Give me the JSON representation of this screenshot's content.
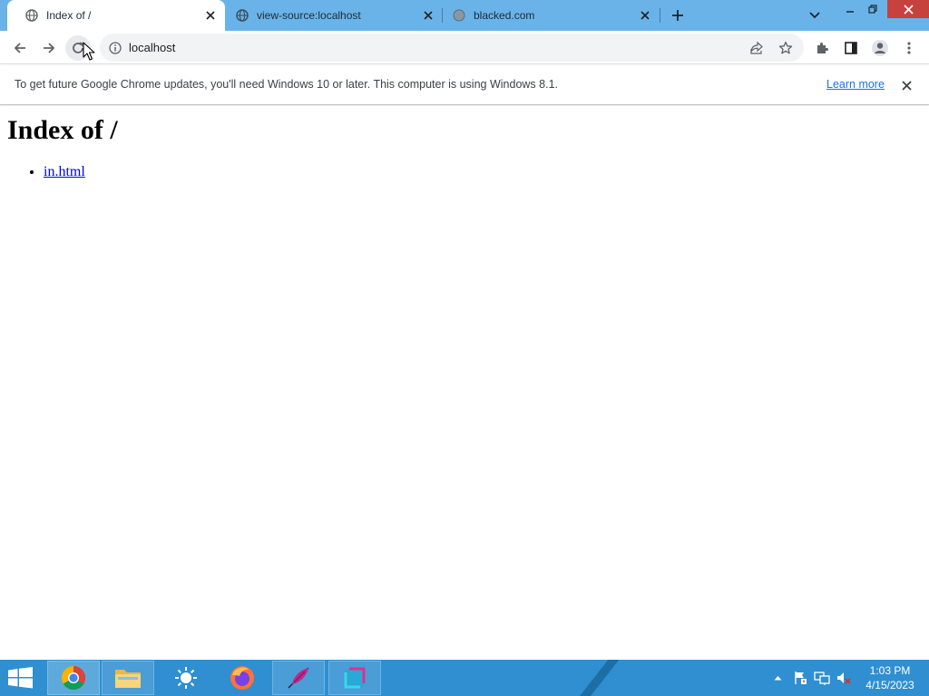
{
  "browser": {
    "tabs": [
      {
        "title": "Index of /",
        "active": true
      },
      {
        "title": "view-source:localhost",
        "active": false
      },
      {
        "title": "blacked.com",
        "active": false
      }
    ],
    "address": "localhost"
  },
  "infobar": {
    "message": "To get future Google Chrome updates, you'll need Windows 10 or later. This computer is using Windows 8.1.",
    "link": "Learn more"
  },
  "page": {
    "heading": "Index of /",
    "files": [
      "in.html"
    ]
  },
  "taskbar": {
    "time": "1:03 PM",
    "date": "4/15/2023"
  },
  "colors": {
    "tabstrip": "#6ab3e8",
    "taskbar": "#2f8fd0",
    "link": "#0000ee"
  },
  "icons": [
    "globe-icon",
    "close-icon",
    "plus-icon",
    "chevron-down-icon",
    "back-icon",
    "forward-icon",
    "reload-icon",
    "info-icon",
    "share-icon",
    "star-icon",
    "extensions-icon",
    "side-panel-icon",
    "profile-icon",
    "menu-icon"
  ]
}
